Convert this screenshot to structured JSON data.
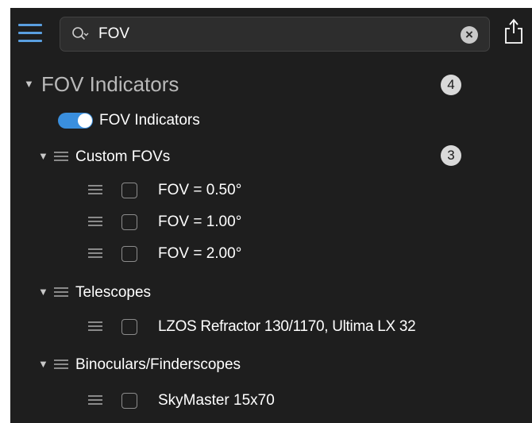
{
  "toolbar": {
    "search": {
      "value": "FOV"
    }
  },
  "tree": {
    "root": {
      "label": "FOV Indicators",
      "count": "4",
      "toggle_label": "FOV Indicators",
      "toggle_on": true
    },
    "groups": [
      {
        "label": "Custom FOVs",
        "count": "3",
        "items": [
          "FOV = 0.50°",
          "FOV = 1.00°",
          "FOV = 2.00°"
        ]
      },
      {
        "label": "Telescopes",
        "items": [
          "LZOS Refractor 130/1170, Ultima LX 32"
        ]
      },
      {
        "label": "Binoculars/Finderscopes",
        "items": [
          "SkyMaster 15x70"
        ]
      }
    ]
  },
  "colors": {
    "accent": "#3a8fde",
    "background": "#1e1e1e",
    "badge": "#d9d9d9"
  }
}
